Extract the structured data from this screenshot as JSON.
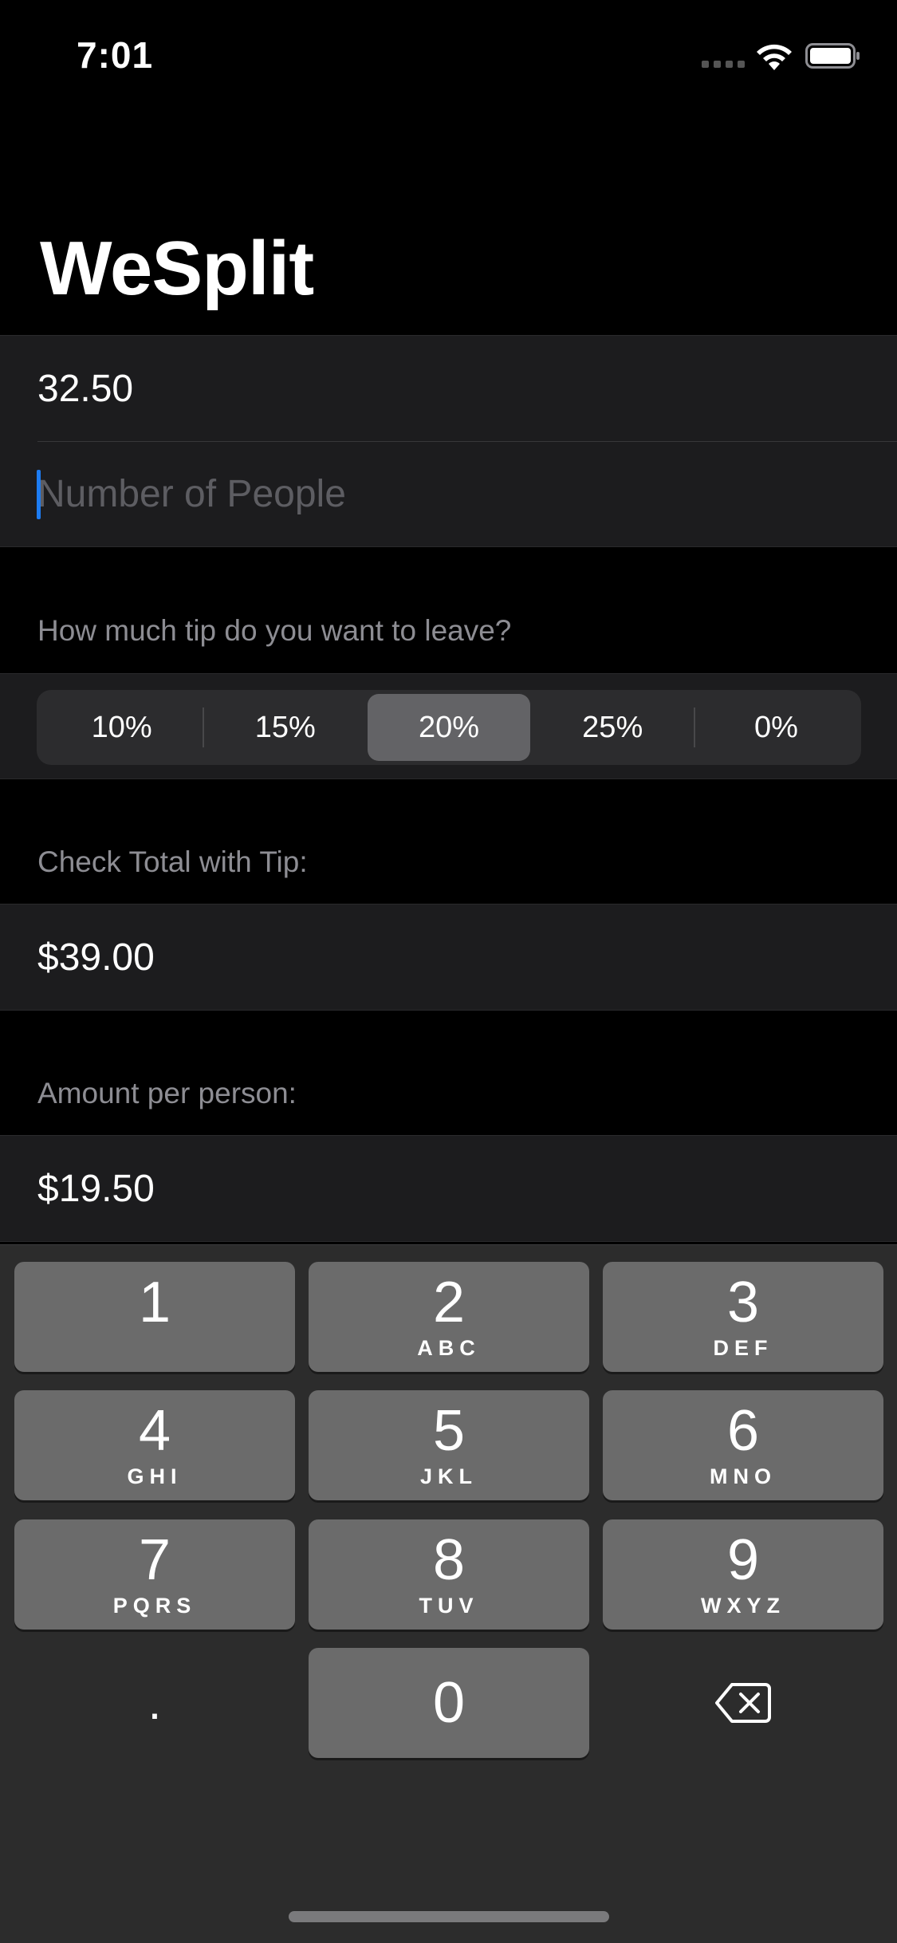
{
  "status_bar": {
    "time": "7:01"
  },
  "nav": {
    "title": "WeSplit"
  },
  "input_section": {
    "check_amount": "32.50",
    "people_placeholder": "Number of People"
  },
  "tip_section": {
    "header": "How much tip do you want to leave?",
    "options": [
      "10%",
      "15%",
      "20%",
      "25%",
      "0%"
    ],
    "selected": "20%"
  },
  "total_section": {
    "header": "Check Total with Tip:",
    "value": "$39.00"
  },
  "per_person_section": {
    "header": "Amount per person:",
    "value": "$19.50"
  },
  "keyboard": {
    "keys": [
      {
        "digit": "1",
        "letters": ""
      },
      {
        "digit": "2",
        "letters": "ABC"
      },
      {
        "digit": "3",
        "letters": "DEF"
      },
      {
        "digit": "4",
        "letters": "GHI"
      },
      {
        "digit": "5",
        "letters": "JKL"
      },
      {
        "digit": "6",
        "letters": "MNO"
      },
      {
        "digit": "7",
        "letters": "PQRS"
      },
      {
        "digit": "8",
        "letters": "TUV"
      },
      {
        "digit": "9",
        "letters": "WXYZ"
      },
      {
        "digit": "0",
        "letters": ""
      }
    ],
    "decimal": ".",
    "delete_icon": "delete-backward-icon"
  }
}
